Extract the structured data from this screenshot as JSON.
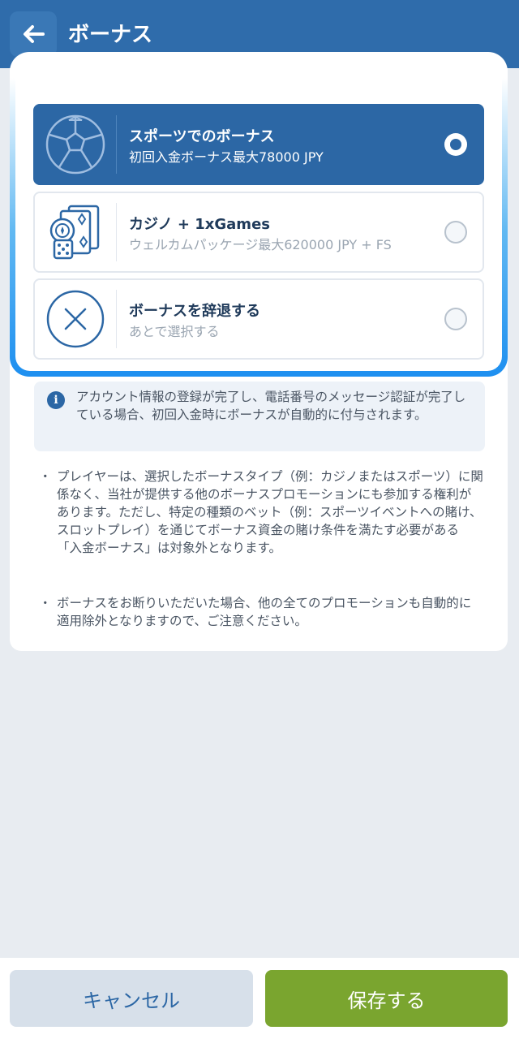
{
  "header": {
    "title": "ボーナス",
    "back_icon": "arrow-left-icon"
  },
  "options": [
    {
      "title": "スポーツでのボーナス",
      "subtitle": "初回入金ボーナス最大78000 JPY",
      "icon": "soccer-ball-icon",
      "selected": true
    },
    {
      "title": "カジノ + 1xGames",
      "subtitle": "ウェルカムパッケージ最大620000 JPY + FS",
      "icon": "casino-cards-icon",
      "selected": false
    },
    {
      "title": "ボーナスを辞退する",
      "subtitle": "あとで選択する",
      "icon": "decline-x-icon",
      "selected": false
    }
  ],
  "info": {
    "icon": "info-icon",
    "text": "アカウント情報の登録が完了し、電話番号のメッセージ認証が完了している場合、初回入金時にボーナスが自動的に付与されます。"
  },
  "notes": [
    "プレイヤーは、選択したボーナスタイプ（例：カジノまたはスポーツ）に関係なく、当社が提供する他のボーナスプロモーションにも参加する権利があります。ただし、特定の種類のベット（例：スポーツイベントへの賭け、スロットプレイ）を通じてボーナス資金の賭け条件を満たす必要がある「入金ボーナス」は対象外となります。",
    "ボーナスをお断りいただいた場合、他の全てのプロモーションも自動的に適用除外となりますので、ご注意ください。"
  ],
  "bullet_char": "・",
  "footer": {
    "cancel_label": "キャンセル",
    "save_label": "保存する"
  },
  "colors": {
    "header": "#2f6cab",
    "selected": "#2c67a5",
    "save": "#7aa52f",
    "cancel": "#d7e0ea"
  }
}
